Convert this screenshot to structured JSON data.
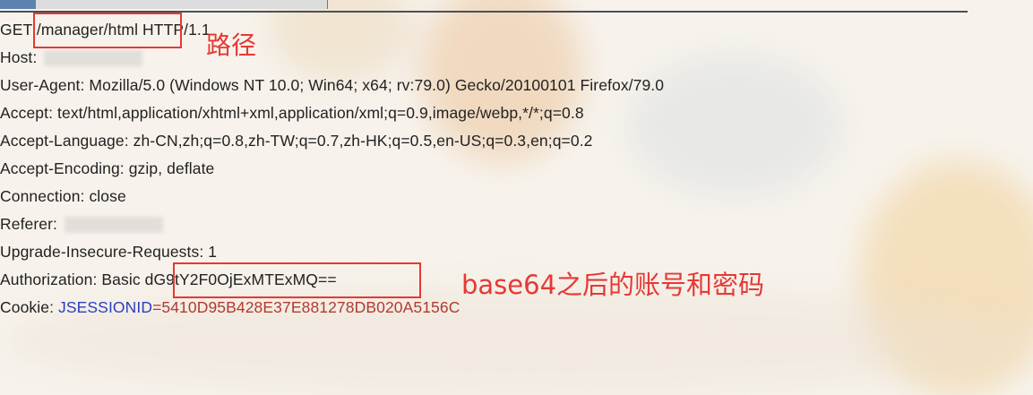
{
  "request": {
    "line1": "GET /manager/html HTTP/1.1",
    "host_label": "Host:",
    "user_agent": "User-Agent: Mozilla/5.0 (Windows NT 10.0; Win64; x64; rv:79.0) Gecko/20100101 Firefox/79.0",
    "accept": "Accept: text/html,application/xhtml+xml,application/xml;q=0.9,image/webp,*/*;q=0.8",
    "accept_language": "Accept-Language: zh-CN,zh;q=0.8,zh-TW;q=0.7,zh-HK;q=0.5,en-US;q=0.3,en;q=0.2",
    "accept_encoding": "Accept-Encoding: gzip, deflate",
    "connection": "Connection: close",
    "referer_label": "Referer:",
    "upgrade": "Upgrade-Insecure-Requests: 1",
    "authorization_label": "Authorization: Basic ",
    "authorization_value": "dG9tY2F0OjExMTExMQ==",
    "cookie_label": "Cookie: ",
    "cookie_name": "JSESSIONID",
    "cookie_eq": "=",
    "cookie_value": "5410D95B428E37E881278DB020A5156C"
  },
  "annotations": {
    "path": "路径",
    "auth": "base64之后的账号和密码"
  },
  "colors": {
    "annotation": "#e53935",
    "cookie_name": "#2a3fbf",
    "cookie_value": "#b23a2f"
  }
}
